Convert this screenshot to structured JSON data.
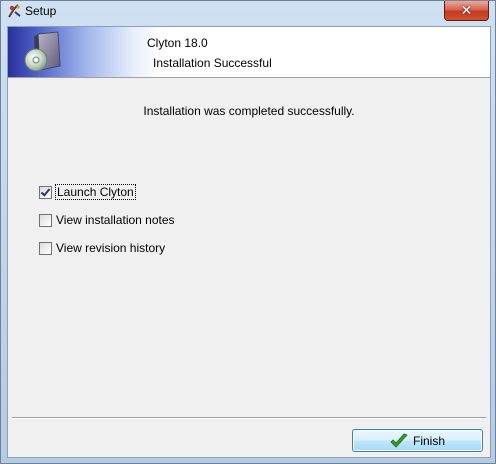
{
  "window": {
    "title": "Setup",
    "close_glyph": "✕"
  },
  "header": {
    "product_name": "Clyton 18.0",
    "subtitle": "Installation Successful"
  },
  "main": {
    "message": "Installation was completed successfully.",
    "options": [
      {
        "label": "Launch Clyton",
        "checked": true
      },
      {
        "label": "View installation notes",
        "checked": false
      },
      {
        "label": "View revision history",
        "checked": false
      }
    ]
  },
  "footer": {
    "finish_label": "Finish"
  },
  "icons": {
    "app": "setup-app-icon",
    "product": "software-box-cd-icon",
    "finish": "green-checkmark-icon",
    "close": "close-icon"
  },
  "colors": {
    "header_gradient_start": "#2a2f9a",
    "dialog_background": "#f0f0f0",
    "close_button": "#c23b22",
    "finish_check": "#3a9d23"
  }
}
